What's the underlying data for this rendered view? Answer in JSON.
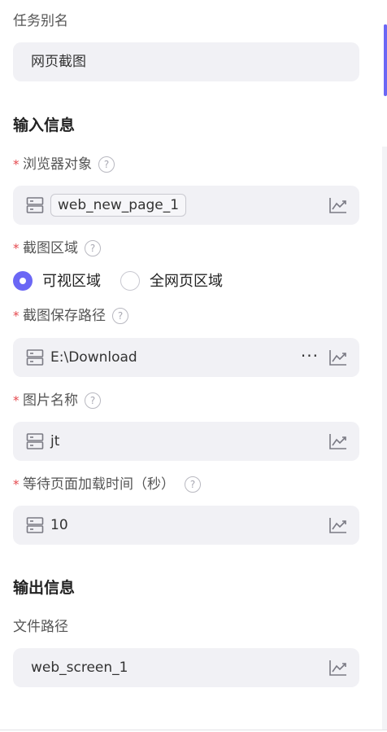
{
  "task_alias": {
    "label": "任务别名",
    "value": "网页截图"
  },
  "input_section": {
    "title": "输入信息",
    "browser_object": {
      "required_mark": "*",
      "label": "浏览器对象",
      "help": "?",
      "value": "web_new_page_1"
    },
    "screenshot_area": {
      "required_mark": "*",
      "label": "截图区域",
      "help": "?",
      "options": [
        "可视区域",
        "全网页区域"
      ],
      "selected": "可视区域"
    },
    "save_path": {
      "required_mark": "*",
      "label": "截图保存路径",
      "help": "?",
      "value": "E:\\Download",
      "more": "···"
    },
    "image_name": {
      "required_mark": "*",
      "label": "图片名称",
      "help": "?",
      "value": "jt"
    },
    "wait_time": {
      "required_mark": "*",
      "label": "等待页面加载时间（秒）",
      "help": "?",
      "value": "10"
    }
  },
  "output_section": {
    "title": "输出信息",
    "file_path": {
      "label": "文件路径",
      "value": "web_screen_1"
    }
  },
  "colors": {
    "accent": "#6b67f5",
    "required": "#e5484d",
    "field_bg": "#f1f1f5"
  }
}
